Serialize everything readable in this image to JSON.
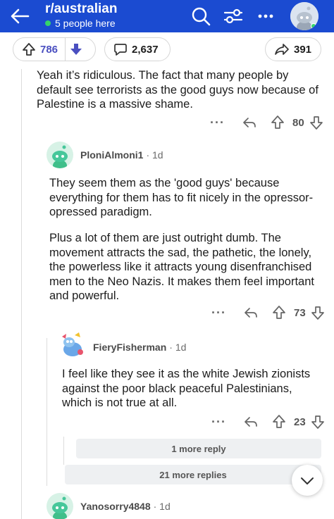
{
  "header": {
    "title": "r/australian",
    "subtitle": "5 people here",
    "colors": {
      "bar": "#1b4bd1",
      "online": "#35d36b"
    }
  },
  "post_actions": {
    "upvotes": "786",
    "comments": "2,637",
    "shares": "391"
  },
  "comments": [
    {
      "id": "parent",
      "body": "Yeah it’s ridiculous. The fact that many people by default see terrorists as the good guys now because of Palestine is a massive shame.",
      "score": "80"
    },
    {
      "id": "reply1",
      "author": "PloniAlmoni1",
      "age": "· 1d",
      "paragraphs": [
        "They seem them as the 'good guys'  because everything for them has to fit nicely in the opressor-opressed paradigm.",
        "Plus a lot of them are just outright dumb.  The movement attracts the sad, the pathetic, the lonely, the powerless like it attracts young disenfranchised men to the Neo Nazis.  It makes them feel important and powerful."
      ],
      "score": "73"
    },
    {
      "id": "reply2",
      "author": "FieryFisherman",
      "age": "· 1d",
      "body": "I feel like they see it as the white Jewish zionists against the poor black peaceful Palestinians, which is not true at all.",
      "score": "23"
    },
    {
      "id": "reply3",
      "author": "Yanosorry4848",
      "age": "· 1d"
    }
  ],
  "more": {
    "one_more": "1 more reply",
    "more_replies": "21 more replies"
  },
  "icons": {
    "back": "back-arrow-icon",
    "search": "search-icon",
    "filter": "filter-icon",
    "more": "more-icon",
    "upvote": "upvote-icon",
    "downvote": "downvote-icon",
    "comment": "comment-icon",
    "share": "share-icon",
    "reply": "reply-icon",
    "chevron": "chevron-down-icon"
  }
}
